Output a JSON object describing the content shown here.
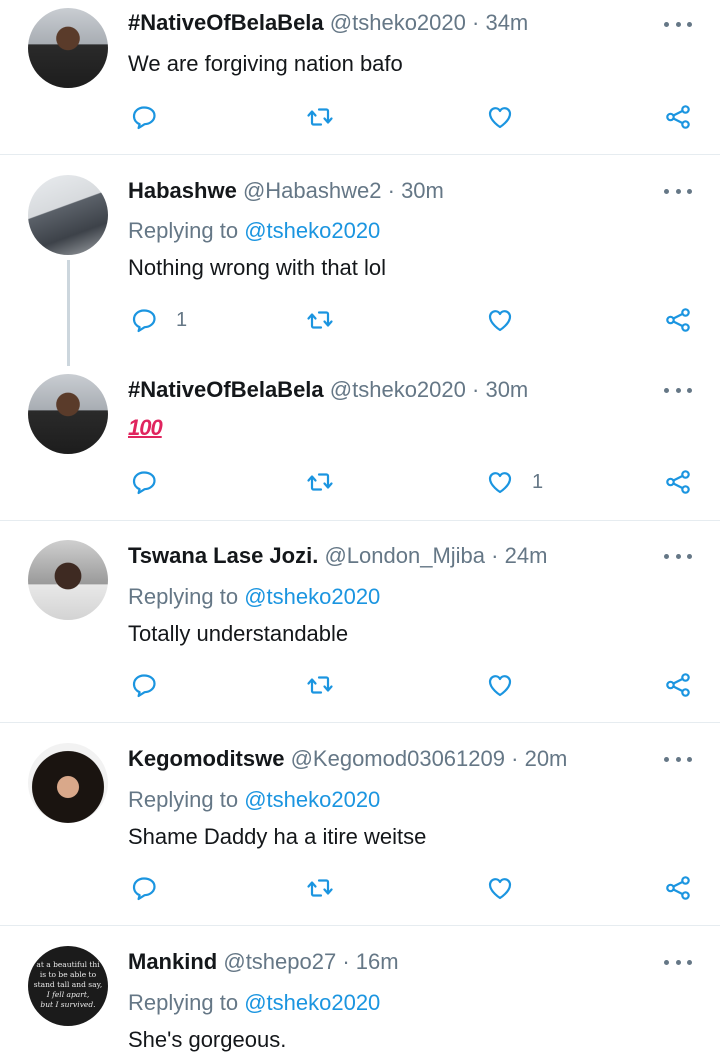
{
  "tweets": [
    {
      "name": "#NativeOfBelaBela",
      "handle": "@tsheko2020",
      "dot": "·",
      "time": "34m",
      "replying_label": "",
      "replying_to": "",
      "text": "We are forgiving nation bafo",
      "replies": "",
      "likes": ""
    },
    {
      "name": "Habashwe",
      "handle": "@Habashwe2",
      "dot": "·",
      "time": "30m",
      "replying_label": "Replying to",
      "replying_to": "@tsheko2020",
      "text": "Nothing wrong with that lol",
      "replies": "1",
      "likes": ""
    },
    {
      "name": "#NativeOfBelaBela",
      "handle": "@tsheko2020",
      "dot": "·",
      "time": "30m",
      "replying_label": "",
      "replying_to": "",
      "text": "100",
      "replies": "",
      "likes": "1"
    },
    {
      "name": "Tswana Lase Jozi.",
      "handle": "@London_Mjiba",
      "dot": "·",
      "time": "24m",
      "replying_label": "Replying to",
      "replying_to": "@tsheko2020",
      "text": "Totally understandable",
      "replies": "",
      "likes": ""
    },
    {
      "name": "Kegomoditswe",
      "handle": "@Kegomod03061209",
      "dot": "·",
      "time": "20m",
      "replying_label": "Replying to",
      "replying_to": "@tsheko2020",
      "text": "Shame Daddy ha a itire weitse",
      "replies": "",
      "likes": ""
    },
    {
      "name": "Mankind",
      "handle": "@tshepo27",
      "dot": "·",
      "time": "16m",
      "replying_label": "Replying to",
      "replying_to": "@tsheko2020",
      "text": "She's gorgeous.",
      "replies": "",
      "likes": ""
    }
  ],
  "avatar_art": {
    "mankind_lines": [
      "at a beautiful thi",
      "is to be able to",
      "stand tall and say,",
      "I fell apart,",
      "but I survived."
    ]
  },
  "icons": {
    "reply": "reply-icon",
    "retweet": "retweet-icon",
    "like": "heart-icon",
    "share": "share-icon",
    "more": "more-options-icon"
  },
  "colors": {
    "accent": "#1b95e0",
    "muted": "#657786",
    "text": "#14171a",
    "divider": "#e6ecf0"
  }
}
